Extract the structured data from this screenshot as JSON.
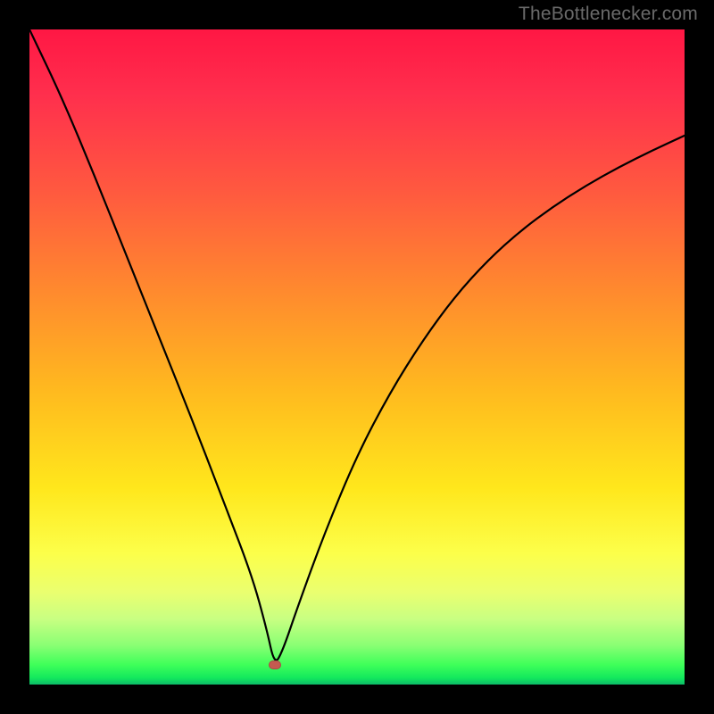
{
  "watermark": "TheBottlenecker.com",
  "marker": {
    "x_frac": 0.374,
    "y_frac": 0.97
  },
  "chart_data": {
    "type": "line",
    "title": "",
    "xlabel": "",
    "ylabel": "",
    "xlim": [
      0,
      1
    ],
    "ylim": [
      0,
      1
    ],
    "grid": false,
    "notch_x": 0.374,
    "series": [
      {
        "name": "bottleneck-curve",
        "x": [
          0.0,
          0.05,
          0.1,
          0.15,
          0.2,
          0.25,
          0.3,
          0.34,
          0.362,
          0.374,
          0.386,
          0.41,
          0.45,
          0.5,
          0.55,
          0.6,
          0.65,
          0.7,
          0.75,
          0.8,
          0.85,
          0.9,
          0.95,
          1.0
        ],
        "y": [
          1.0,
          0.895,
          0.775,
          0.65,
          0.525,
          0.4,
          0.27,
          0.165,
          0.085,
          0.03,
          0.05,
          0.12,
          0.23,
          0.35,
          0.445,
          0.525,
          0.593,
          0.648,
          0.693,
          0.73,
          0.762,
          0.79,
          0.815,
          0.838
        ],
        "color": "#000000"
      }
    ],
    "background_gradient": {
      "type": "vertical",
      "stops": [
        {
          "pos": 0.0,
          "color": "#ff1744"
        },
        {
          "pos": 0.25,
          "color": "#ff5a3f"
        },
        {
          "pos": 0.55,
          "color": "#ffb91f"
        },
        {
          "pos": 0.8,
          "color": "#fcff4a"
        },
        {
          "pos": 0.94,
          "color": "#8aff74"
        },
        {
          "pos": 1.0,
          "color": "#0dbb68"
        }
      ]
    },
    "marker_point": {
      "x": 0.374,
      "y": 0.03,
      "color": "#c45a50"
    }
  }
}
